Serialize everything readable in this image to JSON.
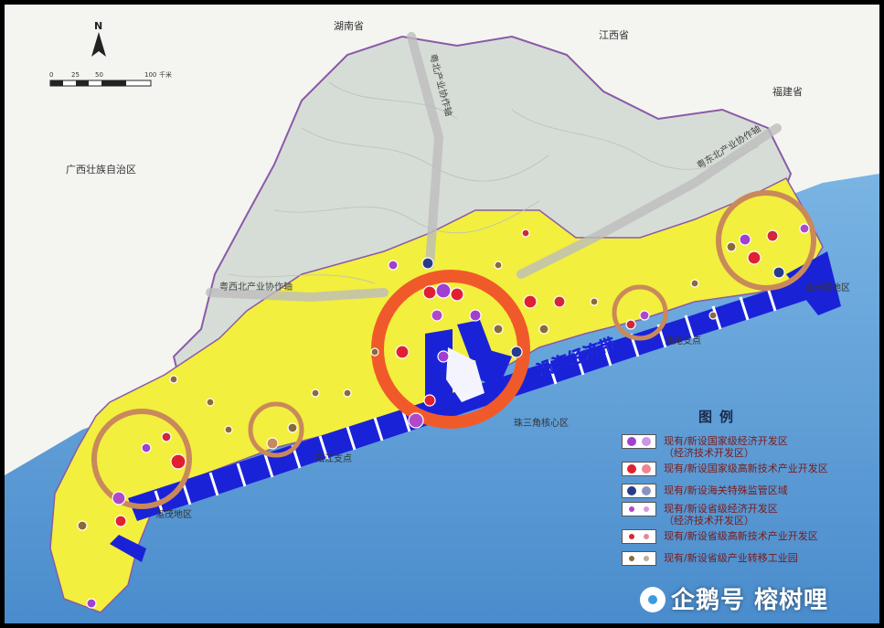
{
  "map": {
    "north_label": "N",
    "scale": {
      "ticks": [
        "0",
        "25",
        "50",
        "100"
      ],
      "unit": "千米"
    },
    "regions": {
      "hunan": "湖南省",
      "jiangxi": "江西省",
      "fujian": "福建省",
      "guangxi": "广西壮族自治区"
    },
    "axes": {
      "north": "粤北产业协作轴",
      "northeast": "粤东北产业协作轴",
      "northwest": "粤西北产业协作轴"
    },
    "belt_label": "沿海经济带",
    "zones": {
      "prd": "珠三角核心区",
      "chaoshan": "汕潮揭地区",
      "shanwei": "汕尾支点",
      "yangjiang": "阳江支点",
      "zhanmao": "湛茂地区"
    },
    "colors": {
      "sea": "#5b9bd5",
      "coastal_land": "#f2ef3e",
      "inland_land": "#d8dfd8",
      "belt": "#1a22d8",
      "ring_major": "#f05a2a",
      "ring_minor": "#c9895a"
    }
  },
  "legend": {
    "title": "图例",
    "items": [
      {
        "text": [
          "现有/新设国家级经济开发区",
          "（经济技术开发区）"
        ],
        "color": "#a040d0"
      },
      {
        "text": [
          "现有/新设国家级高新技术产业开发区"
        ],
        "color": "#e02030"
      },
      {
        "text": [
          "现有/新设海关特殊监管区域"
        ],
        "color": "#2a3a8a"
      },
      {
        "text": [
          "现有/新设省级经济开发区",
          "（经济技术开发区）"
        ],
        "color": "#b048c8"
      },
      {
        "text": [
          "现有/新设省级高新技术产业开发区"
        ],
        "color": "#d02838"
      },
      {
        "text": [
          "现有/新设省级产业转移工业园"
        ],
        "color": "#8a6a3a"
      }
    ]
  },
  "watermark": "企鹅号 榕树哩"
}
